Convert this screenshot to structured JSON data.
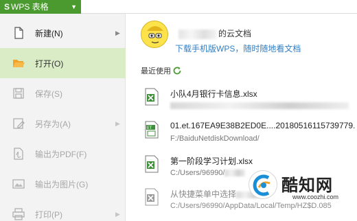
{
  "app": {
    "title": "WPS 表格",
    "logo_letter": "S"
  },
  "menu": {
    "items": [
      {
        "label": "新建(N)",
        "icon": "new-file-icon",
        "has_submenu": true,
        "state": "enabled"
      },
      {
        "label": "打开(O)",
        "icon": "folder-open-icon",
        "has_submenu": false,
        "state": "active"
      },
      {
        "label": "保存(S)",
        "icon": "save-icon",
        "has_submenu": false,
        "state": "disabled"
      },
      {
        "label": "另存为(A)",
        "icon": "save-as-icon",
        "has_submenu": true,
        "state": "disabled"
      },
      {
        "label": "输出为PDF(F)",
        "icon": "export-pdf-icon",
        "has_submenu": false,
        "state": "disabled"
      },
      {
        "label": "输出为图片(G)",
        "icon": "export-image-icon",
        "has_submenu": false,
        "state": "disabled"
      },
      {
        "label": "打印(P)",
        "icon": "print-icon",
        "has_submenu": true,
        "state": "disabled"
      }
    ]
  },
  "cloud": {
    "title_suffix": "的云文档",
    "link": "下载手机版WPS，随时随地看文档"
  },
  "recent": {
    "heading": "最近使用",
    "files": [
      {
        "name": "小队4月银行卡信息.xlsx",
        "path": "",
        "icon": "xlsx-file-icon"
      },
      {
        "name": "01.et.167EA9E38B2ED0E....20180516115739779.",
        "path": "F:/BaiduNetdiskDownload/",
        "icon": "et-file-icon"
      },
      {
        "name": "第一阶段学习计划.xlsx",
        "path": "C:/Users/96990/",
        "icon": "xlsx-file-icon"
      },
      {
        "name": "从快捷菜单中选择",
        "path": "C:/Users/96990/AppData/Local/Temp/HZ$D.085",
        "icon": "missing-file-icon"
      }
    ]
  },
  "watermark": {
    "name": "酷知网",
    "url": "www.coozhi.com"
  },
  "colors": {
    "brand_green": "#4a9a2f",
    "active_bg": "#d9ecc6",
    "link_blue": "#2f7ec4",
    "xlsx_green": "#3f8f3a"
  }
}
